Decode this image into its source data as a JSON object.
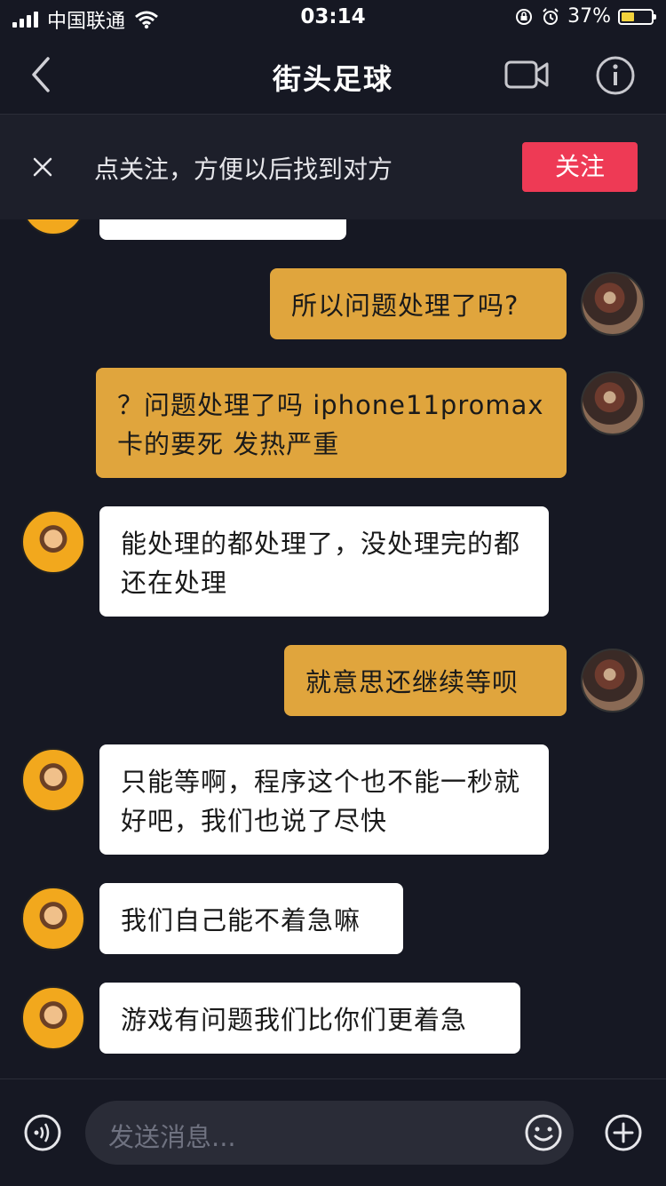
{
  "status_bar": {
    "carrier": "中国联通",
    "time": "03:14",
    "battery": "37%"
  },
  "header": {
    "title": "街头足球",
    "video_icon": "video-camera-icon",
    "info_icon": "info-icon",
    "back_icon": "chevron-left-icon"
  },
  "banner": {
    "text": "点关注，方便以后找到对方",
    "follow_label": "关注"
  },
  "messages": [
    {
      "side": "them",
      "text": ""
    },
    {
      "side": "me",
      "text": "所以问题处理了吗?"
    },
    {
      "side": "me",
      "text": "？问题处理了吗 iphone11promax 卡的要死 发热严重"
    },
    {
      "side": "them",
      "text": "能处理的都处理了，没处理完的都还在处理"
    },
    {
      "side": "me",
      "text": "就意思还继续等呗"
    },
    {
      "side": "them",
      "text": "只能等啊，程序这个也不能一秒就好吧，我们也说了尽快"
    },
    {
      "side": "them",
      "text": "我们自己能不着急嘛"
    },
    {
      "side": "them",
      "text": "游戏有问题我们比你们更着急"
    }
  ],
  "composer": {
    "placeholder": "发送消息..."
  },
  "colors": {
    "background": "#161823",
    "my_bubble": "#e0a53d",
    "their_bubble": "#ffffff",
    "follow_button": "#ee3a55"
  }
}
